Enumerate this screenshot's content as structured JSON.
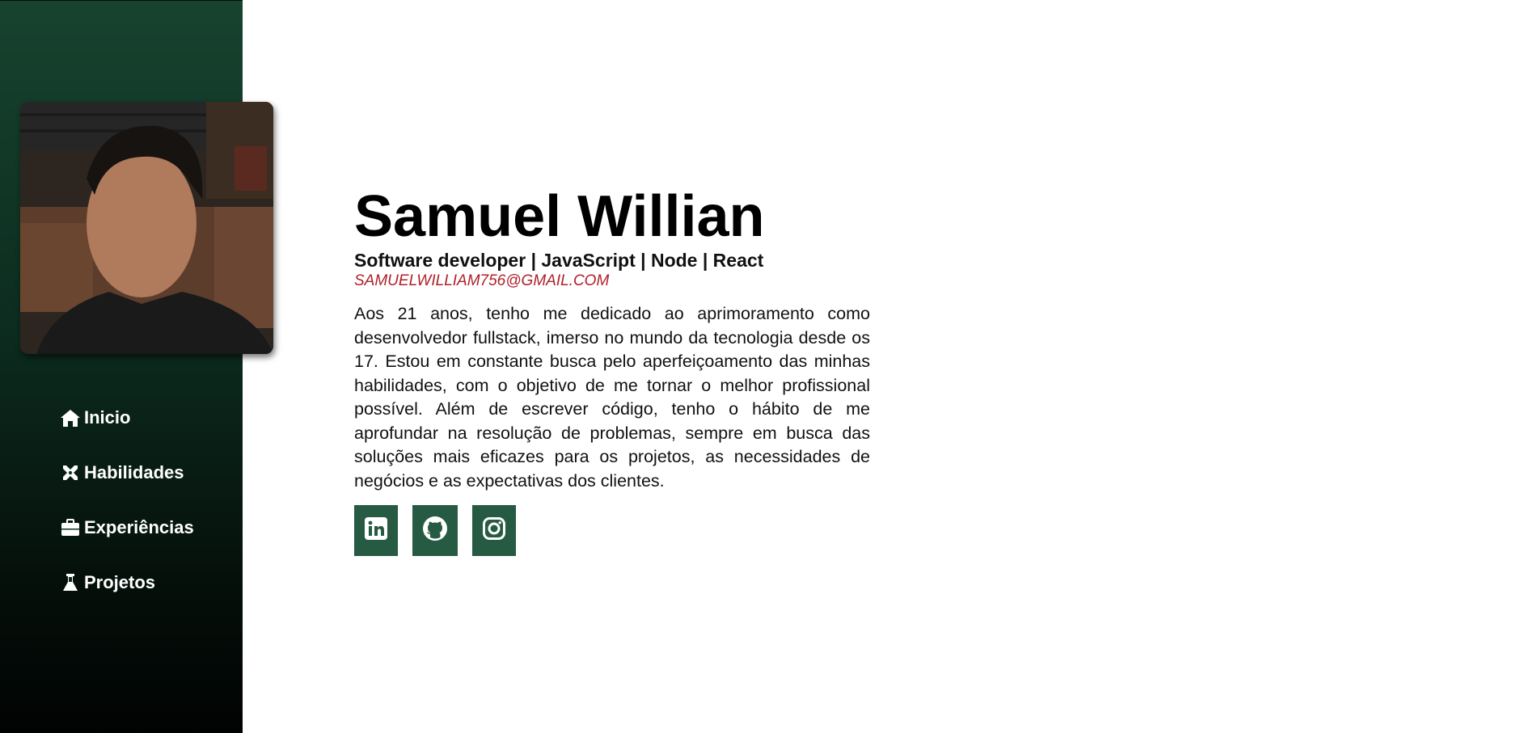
{
  "profile": {
    "name": "Samuel Willian",
    "headline": "Software developer | JavaScript | Node | React",
    "email": "SAMUELWILLIAM756@GMAIL.COM",
    "bio": "Aos 21 anos, tenho me dedicado ao aprimoramento como desenvolvedor fullstack, imerso no mundo da tecnologia desde os 17. Estou em constante busca pelo aperfeiçoamento das minhas habilidades, com o objetivo de me tornar o melhor profissional possível. Além de escrever código, tenho o hábito de me aprofundar na resolução de problemas, sempre em busca das soluções mais eficazes para os projetos, as necessidades de negócios e as expectativas dos clientes."
  },
  "nav": {
    "items": [
      {
        "label": "Inicio",
        "icon": "home-icon"
      },
      {
        "label": "Habilidades",
        "icon": "tools-icon"
      },
      {
        "label": "Experiências",
        "icon": "briefcase-icon"
      },
      {
        "label": "Projetos",
        "icon": "flask-icon"
      }
    ]
  },
  "socials": [
    {
      "icon": "linkedin-icon"
    },
    {
      "icon": "github-icon"
    },
    {
      "icon": "instagram-icon"
    }
  ],
  "colors": {
    "sidebar_top": "#17432f",
    "sidebar_bottom": "#010302",
    "social_bg": "#265a43",
    "email": "#b0202a"
  }
}
